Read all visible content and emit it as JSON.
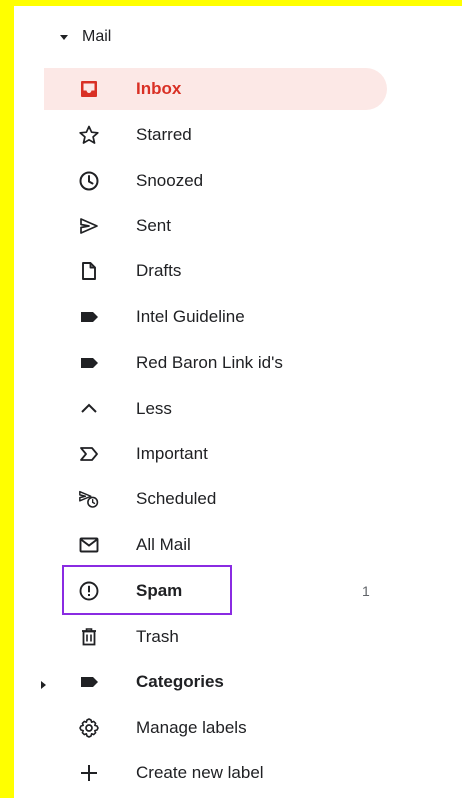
{
  "section": {
    "label": "Mail",
    "expanded": true,
    "icon": "caret-down-icon"
  },
  "items": [
    {
      "label": "Inbox",
      "icon": "inbox-icon",
      "active": true,
      "bold": true,
      "count": ""
    },
    {
      "label": "Starred",
      "icon": "star-icon",
      "active": false,
      "bold": false,
      "count": ""
    },
    {
      "label": "Snoozed",
      "icon": "clock-icon",
      "active": false,
      "bold": false,
      "count": ""
    },
    {
      "label": "Sent",
      "icon": "send-icon",
      "active": false,
      "bold": false,
      "count": ""
    },
    {
      "label": "Drafts",
      "icon": "draft-icon",
      "active": false,
      "bold": false,
      "count": ""
    },
    {
      "label": "Intel Guideline",
      "icon": "label-icon",
      "active": false,
      "bold": false,
      "count": ""
    },
    {
      "label": "Red Baron Link id's",
      "icon": "label-icon",
      "active": false,
      "bold": false,
      "count": ""
    },
    {
      "label": "Less",
      "icon": "chevron-up-icon",
      "active": false,
      "bold": false,
      "count": ""
    },
    {
      "label": "Important",
      "icon": "important-icon",
      "active": false,
      "bold": false,
      "count": ""
    },
    {
      "label": "Scheduled",
      "icon": "scheduled-send-icon",
      "active": false,
      "bold": false,
      "count": ""
    },
    {
      "label": "All Mail",
      "icon": "mail-icon",
      "active": false,
      "bold": false,
      "count": ""
    },
    {
      "label": "Spam",
      "icon": "report-icon",
      "active": false,
      "bold": true,
      "count": "1",
      "highlighted": true
    },
    {
      "label": "Trash",
      "icon": "trash-icon",
      "active": false,
      "bold": false,
      "count": ""
    },
    {
      "label": "Categories",
      "icon": "label-icon",
      "active": false,
      "bold": true,
      "count": "",
      "collapsed": true
    },
    {
      "label": "Manage labels",
      "icon": "gear-icon",
      "active": false,
      "bold": false,
      "count": ""
    },
    {
      "label": "Create new label",
      "icon": "plus-icon",
      "active": false,
      "bold": false,
      "count": ""
    }
  ],
  "colors": {
    "background": "#ffff00",
    "panel": "#ffffff",
    "active_bg": "#fce8e6",
    "active_text": "#d93025",
    "text": "#202124",
    "icon": "#202124",
    "highlight_border": "#8a2be2"
  }
}
